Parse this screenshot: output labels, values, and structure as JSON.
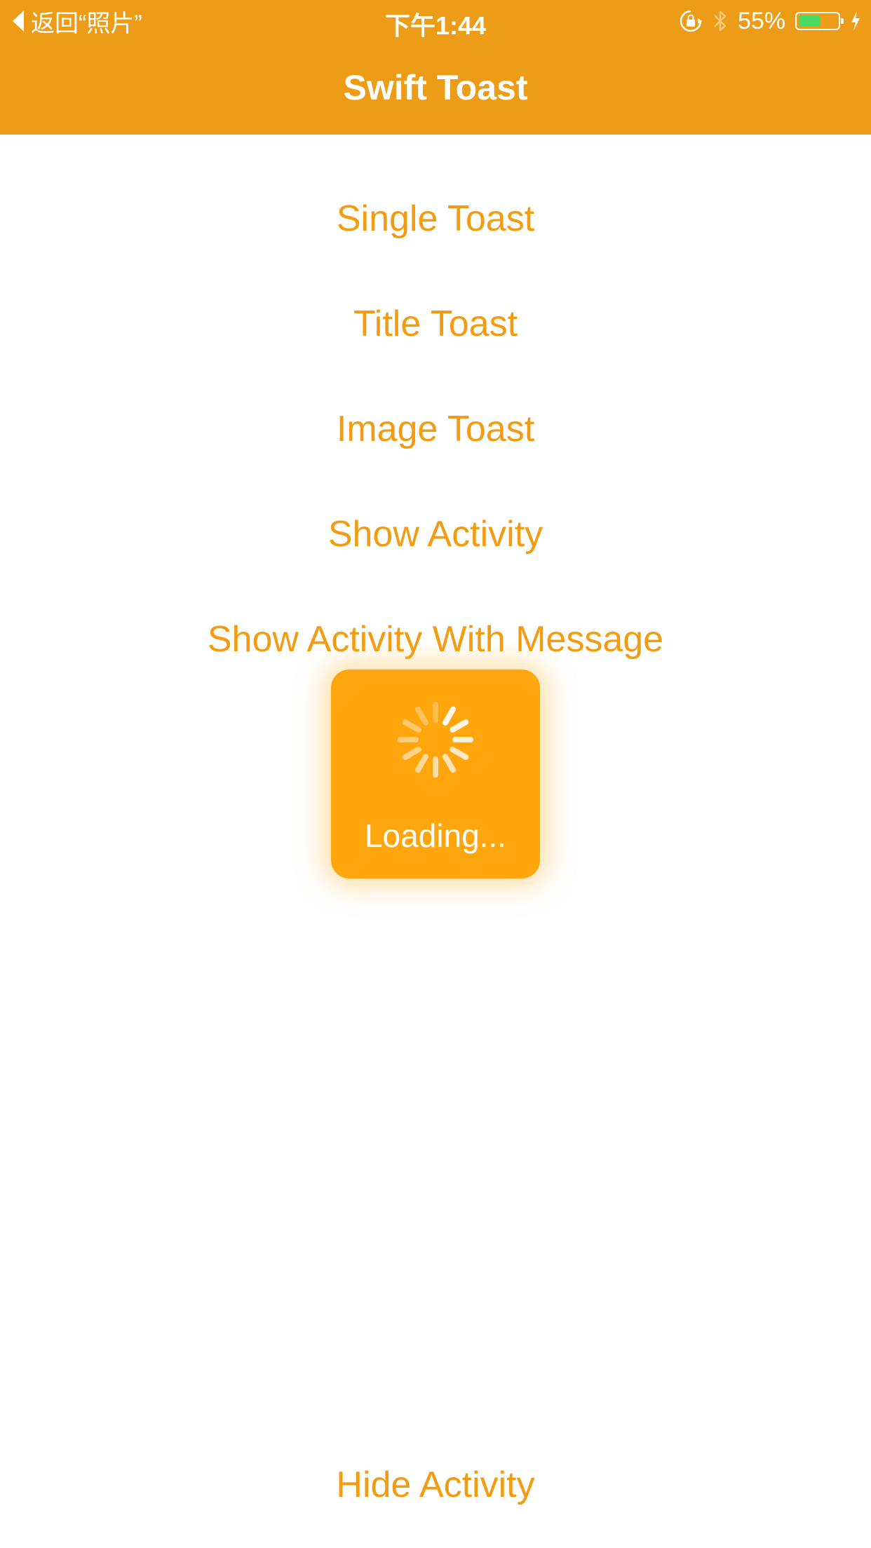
{
  "status_bar": {
    "back_label": "返回“照片”",
    "time": "下午1:44",
    "battery_percent": "55%",
    "battery_level": 0.55,
    "icons": [
      "orientation-lock-icon",
      "bluetooth-icon",
      "battery-icon",
      "charging-bolt-icon"
    ]
  },
  "nav": {
    "title": "Swift Toast"
  },
  "menu": {
    "single_toast": "Single Toast",
    "title_toast": "Title Toast",
    "image_toast": "Image Toast",
    "show_activity": "Show Activity",
    "show_activity_message": "Show Activity With Message",
    "hide_activity": "Hide Activity"
  },
  "toast": {
    "message": "Loading...",
    "icon": "activity-spinner-icon"
  },
  "colors": {
    "nav_background": "#EC9C17",
    "button_text": "#F39C12",
    "toast_background": "#FFA60F",
    "battery_fill": "#4CD964"
  }
}
